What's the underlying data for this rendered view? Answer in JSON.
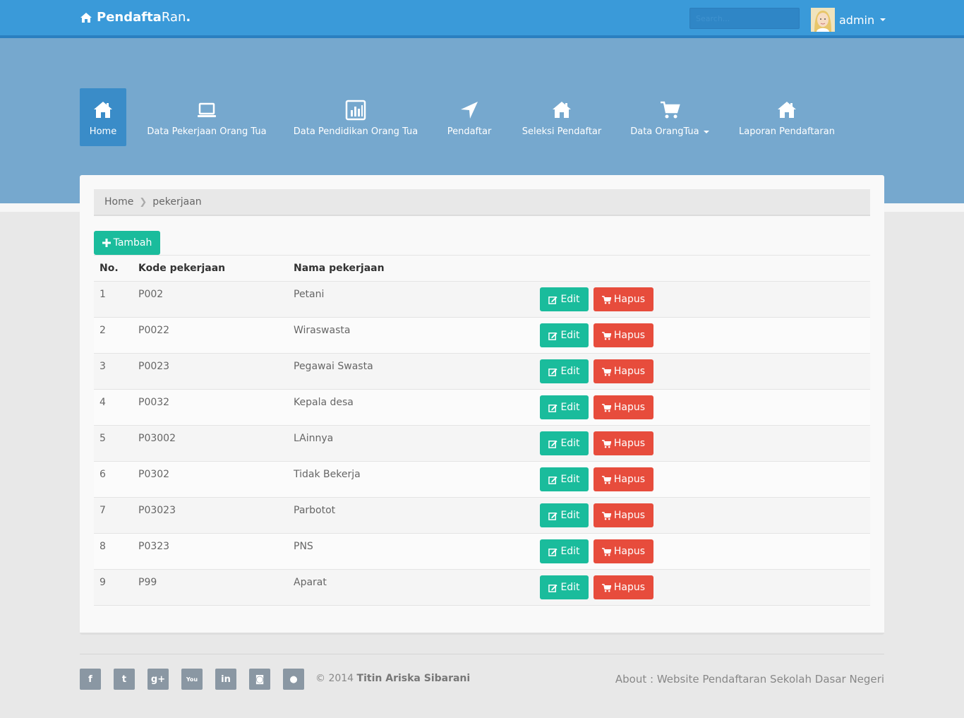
{
  "brand": {
    "bold": "Pendafta",
    "light": "Ran",
    "dot": "."
  },
  "search": {
    "placeholder": "Search..."
  },
  "user": {
    "name": "admin"
  },
  "nav": [
    {
      "label": "Home",
      "icon": "home-icon",
      "active": true
    },
    {
      "label": "Data Pekerjaan Orang Tua",
      "icon": "laptop-icon"
    },
    {
      "label": "Data Pendidikan Orang Tua",
      "icon": "bar-chart-icon"
    },
    {
      "label": "Pendaftar",
      "icon": "location-arrow-icon"
    },
    {
      "label": "Seleksi Pendaftar",
      "icon": "home-icon"
    },
    {
      "label": "Data OrangTua",
      "icon": "cart-icon",
      "dropdown": true
    },
    {
      "label": "Laporan Pendaftaran",
      "icon": "home-icon"
    }
  ],
  "breadcrumb": {
    "home": "Home",
    "current": "pekerjaan"
  },
  "add_button": "Tambah",
  "table": {
    "headers": [
      "No.",
      "Kode pekerjaan",
      "Nama pekerjaan"
    ],
    "edit_label": "Edit",
    "delete_label": "Hapus",
    "rows": [
      {
        "no": "1",
        "kode": "P002",
        "nama": "Petani"
      },
      {
        "no": "2",
        "kode": "P0022",
        "nama": "Wiraswasta"
      },
      {
        "no": "3",
        "kode": "P0023",
        "nama": "Pegawai Swasta"
      },
      {
        "no": "4",
        "kode": "P0032",
        "nama": "Kepala desa"
      },
      {
        "no": "5",
        "kode": "P03002",
        "nama": "LAinnya"
      },
      {
        "no": "6",
        "kode": "P0302",
        "nama": "Tidak Bekerja"
      },
      {
        "no": "7",
        "kode": "P03023",
        "nama": "Parbotot"
      },
      {
        "no": "8",
        "kode": "P0323",
        "nama": "PNS"
      },
      {
        "no": "9",
        "kode": "P99",
        "nama": "Aparat"
      }
    ]
  },
  "footer": {
    "social": [
      {
        "icon": "facebook-icon",
        "glyph": "f"
      },
      {
        "icon": "twitter-icon",
        "glyph": "t"
      },
      {
        "icon": "google-plus-icon",
        "glyph": "g+"
      },
      {
        "icon": "youtube-icon",
        "glyph": "You"
      },
      {
        "icon": "linkedin-icon",
        "glyph": "in"
      },
      {
        "icon": "instagram-icon",
        "glyph": "◙"
      },
      {
        "icon": "github-icon",
        "glyph": "●"
      }
    ],
    "copyright_prefix": "© 2014",
    "copyright_name": "Titin Ariska Sibarani",
    "about": "About : Website Pendaftaran Sekolah Dasar Negeri"
  },
  "colors": {
    "topbar": "#3a9ad9",
    "hero": "#76a8ce",
    "success": "#1abc9c",
    "danger": "#e74c3c"
  }
}
